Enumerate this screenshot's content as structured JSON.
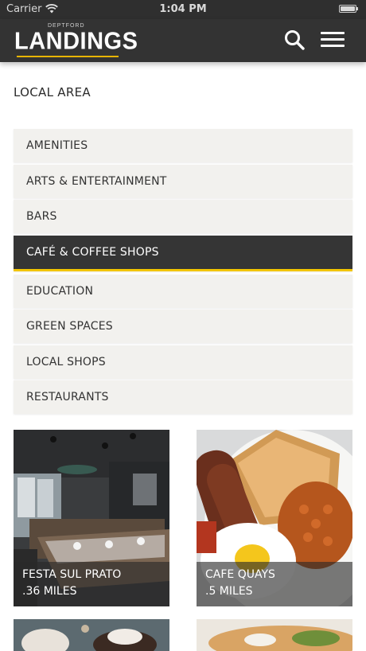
{
  "status_bar": {
    "carrier": "Carrier",
    "time": "1:04 PM"
  },
  "header": {
    "logo_small": "DEPTFORD",
    "logo_big": "LANDINGS",
    "colors": {
      "background": "#333333",
      "accent": "#e8b400"
    }
  },
  "section": {
    "title": "LOCAL AREA"
  },
  "categories": [
    {
      "label": "AMENITIES"
    },
    {
      "label": "ARTS & ENTERTAINMENT"
    },
    {
      "label": "BARS"
    },
    {
      "label": "CAFÉ & COFFEE SHOPS"
    },
    {
      "label": "EDUCATION"
    },
    {
      "label": "GREEN SPACES"
    },
    {
      "label": "LOCAL SHOPS"
    },
    {
      "label": "RESTAURANTS"
    }
  ],
  "selected_category": "CAFÉ & COFFEE SHOPS",
  "places": [
    {
      "name": "FESTA SUL PRATO",
      "distance": ".36 MILES",
      "image": "restaurant-interior"
    },
    {
      "name": "CAFE QUAYS",
      "distance": ".5 MILES",
      "image": "full-breakfast"
    },
    {
      "name": "",
      "distance": "",
      "image": "dessert"
    },
    {
      "name": "",
      "distance": "",
      "image": "sandwich"
    }
  ],
  "icons": {
    "search": "search-icon",
    "menu": "hamburger-menu-icon",
    "wifi": "wifi-icon",
    "battery": "battery-icon"
  },
  "colors": {
    "active_category_bg": "#353535",
    "active_underline": "#f2c500",
    "category_bg": "#f2f1ee"
  }
}
